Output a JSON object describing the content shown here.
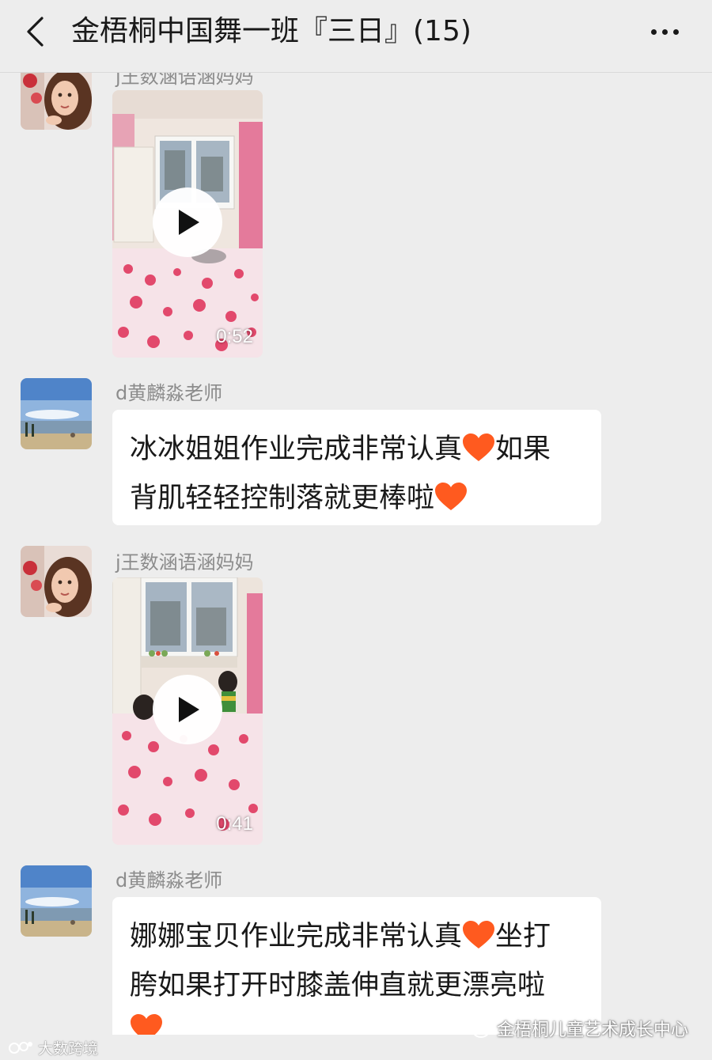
{
  "header": {
    "title": "金梧桐中国舞一班『三日』(15)",
    "back_icon": "chevron-left-icon",
    "more_icon": "more-dots-icon"
  },
  "messages": [
    {
      "type": "video",
      "sender": "j王数涵语涵妈妈",
      "duration": "0:52"
    },
    {
      "type": "text",
      "sender": "d黄麟淼老师",
      "line1": "冰冰姐姐作业完成非常认真",
      "line1b": "如果",
      "line2": "背肌轻轻控制落就更棒啦"
    },
    {
      "type": "video",
      "sender": "j王数涵语涵妈妈",
      "duration": "0:41"
    },
    {
      "type": "text",
      "sender": "d黄麟淼老师",
      "line1": "娜娜宝贝作业完成非常认真",
      "line1b": "坐打",
      "line2": "胯如果打开时膝盖伸直就更漂亮啦"
    }
  ],
  "watermarks": {
    "left": "大数跨境",
    "right": "金梧桐儿童艺术成长中心"
  },
  "colors": {
    "background": "#ededed",
    "bubble": "#ffffff",
    "heart": "#ff5a1f"
  }
}
